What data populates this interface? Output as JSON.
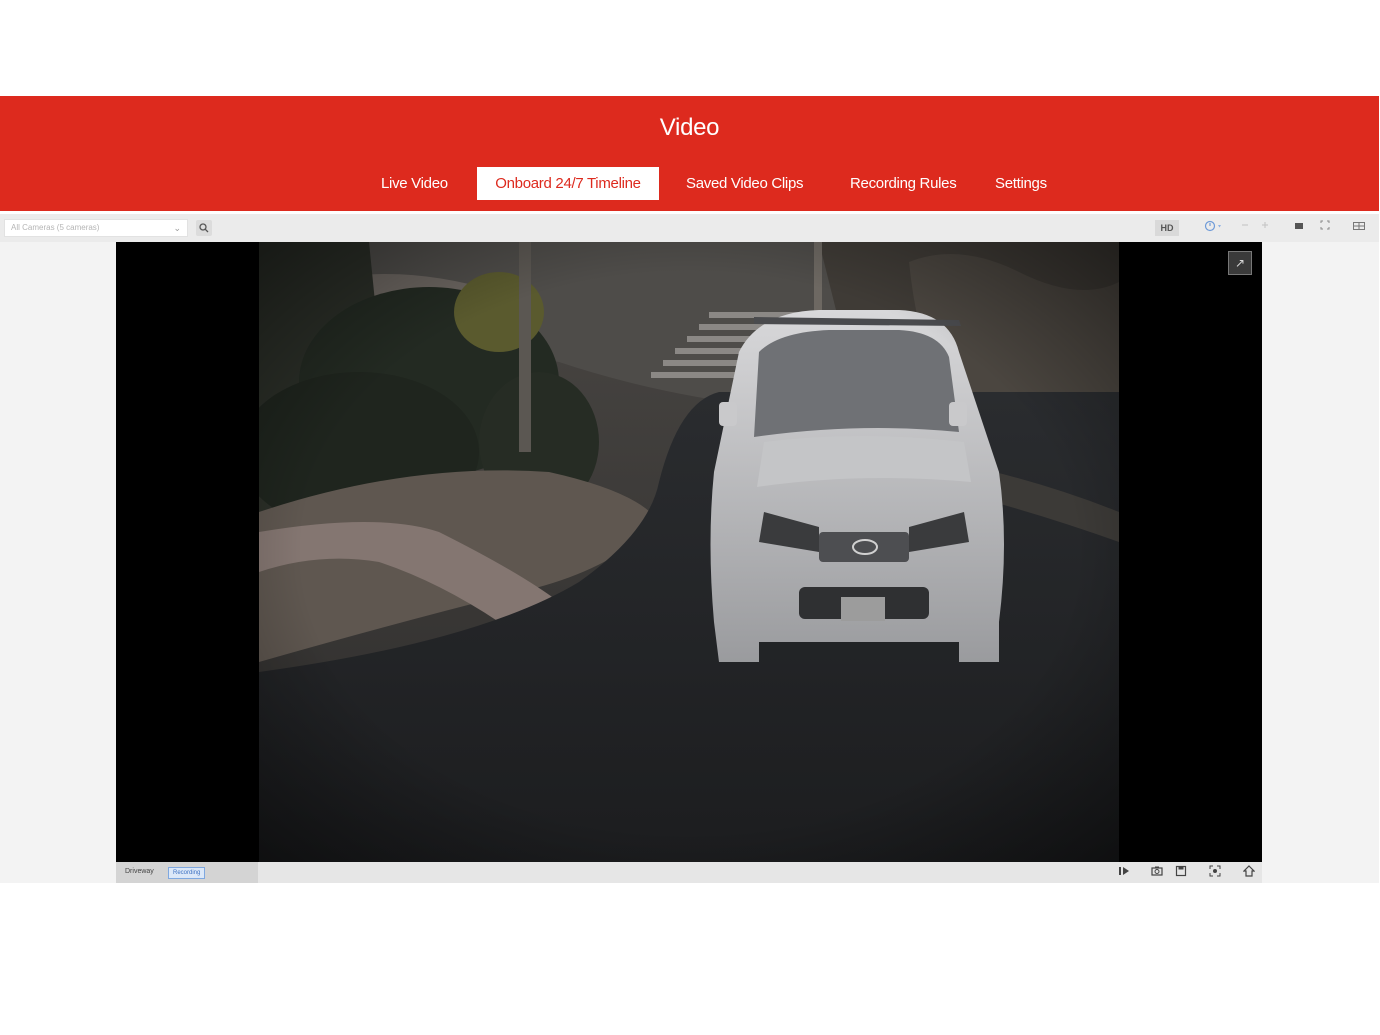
{
  "header": {
    "title": "Video",
    "accent_color": "#dd2a1e"
  },
  "tabs": [
    {
      "label": "Live Video",
      "active": false
    },
    {
      "label": "Onboard 24/7 Timeline",
      "active": true
    },
    {
      "label": "Saved Video Clips",
      "active": false
    },
    {
      "label": "Recording Rules",
      "active": false
    },
    {
      "label": "Settings",
      "active": false
    }
  ],
  "toolbar": {
    "camera_select": {
      "value": "All Cameras (5 cameras)",
      "icon": "chevron-down-icon"
    },
    "search_icon": "search-icon",
    "hd_label": "HD",
    "icons": [
      "speed-icon",
      "step-back-icon",
      "step-forward-icon",
      "single-view-icon",
      "fullscreen-icon",
      "grid-view-icon"
    ]
  },
  "player": {
    "camera_name": "Driveway",
    "recording_badge": "Recording",
    "expand_icon": "expand-icon",
    "controls": [
      "play-pause-icon",
      "snapshot-icon",
      "save-clip-icon",
      "zoom-icon",
      "settings-icon"
    ]
  }
}
